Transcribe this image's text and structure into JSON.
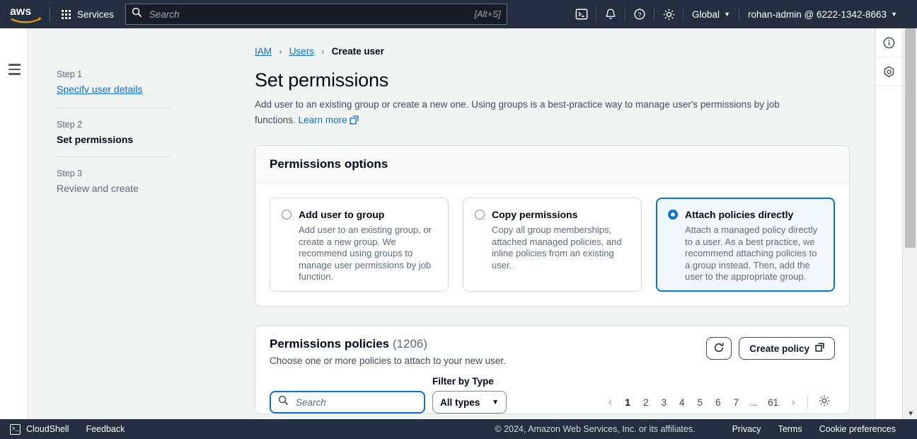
{
  "topnav": {
    "logo_alt": "aws",
    "services_label": "Services",
    "search_placeholder": "Search",
    "search_value": "",
    "search_shortcut": "[Alt+S]",
    "icons": [
      "cloudshell-icon",
      "notifications-bell-icon",
      "help-question-icon",
      "settings-gear-icon"
    ],
    "region_label": "Global",
    "account_label": "rohan-admin @ 6222-1342-8663"
  },
  "breadcrumb": {
    "items": [
      {
        "label": "IAM",
        "current": false
      },
      {
        "label": "Users",
        "current": false
      },
      {
        "label": "Create user",
        "current": true
      }
    ],
    "separator": "›"
  },
  "sidebar": {
    "steps": [
      {
        "number": "Step 1",
        "title": "Specify user details",
        "state": "link"
      },
      {
        "number": "Step 2",
        "title": "Set permissions",
        "state": "active"
      },
      {
        "number": "Step 3",
        "title": "Review and create",
        "state": "plain"
      }
    ]
  },
  "page": {
    "title": "Set permissions",
    "description": "Add user to an existing group or create a new one. Using groups is a best-practice way to manage user's permissions by job functions.",
    "learn_more": "Learn more"
  },
  "permissions_options": {
    "heading": "Permissions options",
    "options": [
      {
        "label": "Add user to group",
        "description": "Add user to an existing group, or create a new group. We recommend using groups to manage user permissions by job function.",
        "selected": false
      },
      {
        "label": "Copy permissions",
        "description": "Copy all group memberships, attached managed policies, and inline policies from an existing user.",
        "selected": false
      },
      {
        "label": "Attach policies directly",
        "description": "Attach a managed policy directly to a user. As a best practice, we recommend attaching policies to a group instead. Then, add the user to the appropriate group.",
        "selected": true
      }
    ]
  },
  "permissions_policies": {
    "heading": "Permissions policies",
    "count": "(1206)",
    "subtitle": "Choose one or more policies to attach to your new user.",
    "refresh_label": "",
    "create_policy_label": "Create policy",
    "search_placeholder": "Search",
    "search_value": "",
    "filter_caption": "Filter by Type",
    "filter_value": "All types",
    "pagination": {
      "prev": "‹",
      "next": "›",
      "pages": [
        "1",
        "2",
        "3",
        "4",
        "5",
        "6",
        "7"
      ],
      "ellipsis": "...",
      "last": "61",
      "active": "1",
      "settings_icon": "preferences-gear-icon"
    }
  },
  "right_rail": {
    "buttons": [
      "info-circle-icon",
      "security-shield-icon"
    ]
  },
  "footer": {
    "cloudshell_label": "CloudShell",
    "feedback_label": "Feedback",
    "copyright": "© 2024, Amazon Web Services, Inc. or its affiliates.",
    "links": [
      "Privacy",
      "Terms",
      "Cookie preferences"
    ]
  },
  "colors": {
    "nav_bg": "#232f3e",
    "accent_blue": "#0972d3",
    "selected_card_bg": "#f2f8fd",
    "page_bg": "#f2f3f3"
  }
}
